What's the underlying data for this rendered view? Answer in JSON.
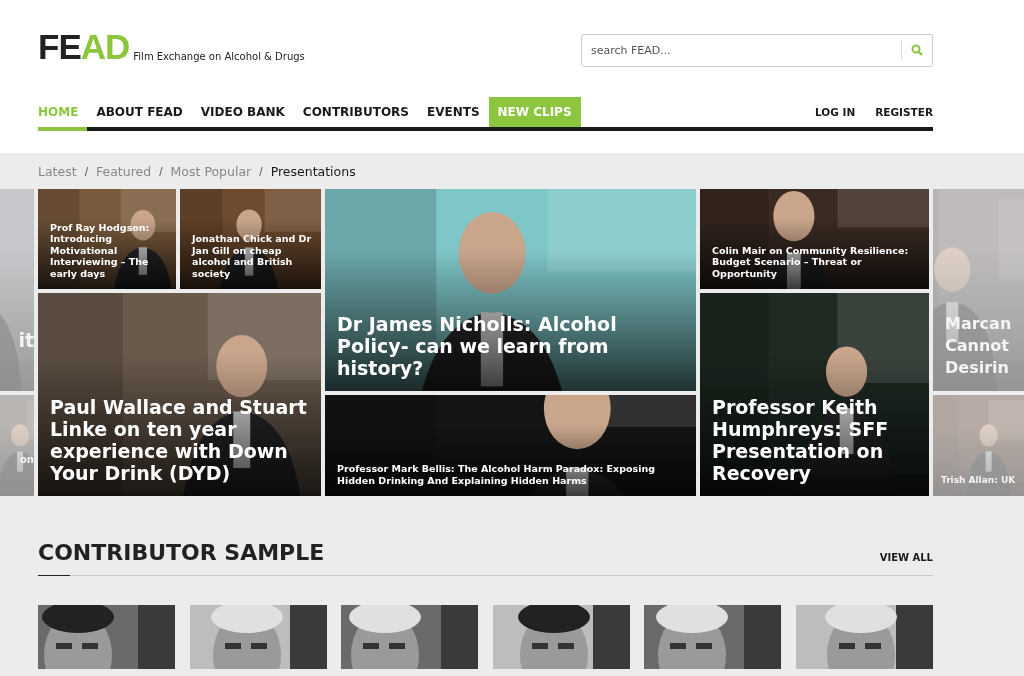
{
  "logo": {
    "dark": "FE",
    "accent": "AD",
    "tagline": "Film Exchange on Alcohol & Drugs"
  },
  "search": {
    "placeholder": "search FEAD..."
  },
  "nav": [
    {
      "label": "HOME",
      "selected": true,
      "highlight": false
    },
    {
      "label": "ABOUT FEAD",
      "selected": false,
      "highlight": false
    },
    {
      "label": "VIDEO BANK",
      "selected": false,
      "highlight": false
    },
    {
      "label": "CONTRIBUTORS",
      "selected": false,
      "highlight": false
    },
    {
      "label": "EVENTS",
      "selected": false,
      "highlight": false
    },
    {
      "label": "NEW CLIPS",
      "selected": false,
      "highlight": true
    }
  ],
  "account_links": [
    "LOG IN",
    "REGISTER"
  ],
  "filter_separator": "/",
  "filters": [
    {
      "label": "Latest",
      "selected": false
    },
    {
      "label": "Featured",
      "selected": false
    },
    {
      "label": "Most Popular",
      "selected": false
    },
    {
      "label": "Presentations",
      "selected": true
    }
  ],
  "tiles": [
    {
      "title": "it",
      "faded": true
    },
    {
      "title": "on",
      "faded": true
    },
    {
      "title": "Prof Ray Hodgson: Introducing Motivational Interviewing – The early days",
      "faded": false
    },
    {
      "title": "Jonathan Chick and Dr Jan Gill on cheap alcohol and British society",
      "faded": false
    },
    {
      "title": "Paul Wallace and Stuart Linke on ten year experience with Down Your Drink (DYD)",
      "faded": false
    },
    {
      "title": "Dr James Nicholls: Alcohol Policy- can we learn from history?",
      "faded": false
    },
    {
      "title": "Professor Mark Bellis: The Alcohol Harm Paradox: Exposing Hidden Drinking And Explaining Hidden Harms",
      "faded": false
    },
    {
      "title": "Colin Mair on Community Resilience: Budget Scenario – Threat or Opportunity",
      "faded": false
    },
    {
      "title": "Professor Keith Humphreys: SFF Presentation on Recovery",
      "faded": false
    },
    {
      "title": "Marcan Cannot Desirin",
      "faded": true
    },
    {
      "title": "Trish Allan: UK",
      "faded": true
    }
  ],
  "contributors": {
    "title": "CONTRIBUTOR SAMPLE",
    "view_all": "VIEW ALL"
  }
}
